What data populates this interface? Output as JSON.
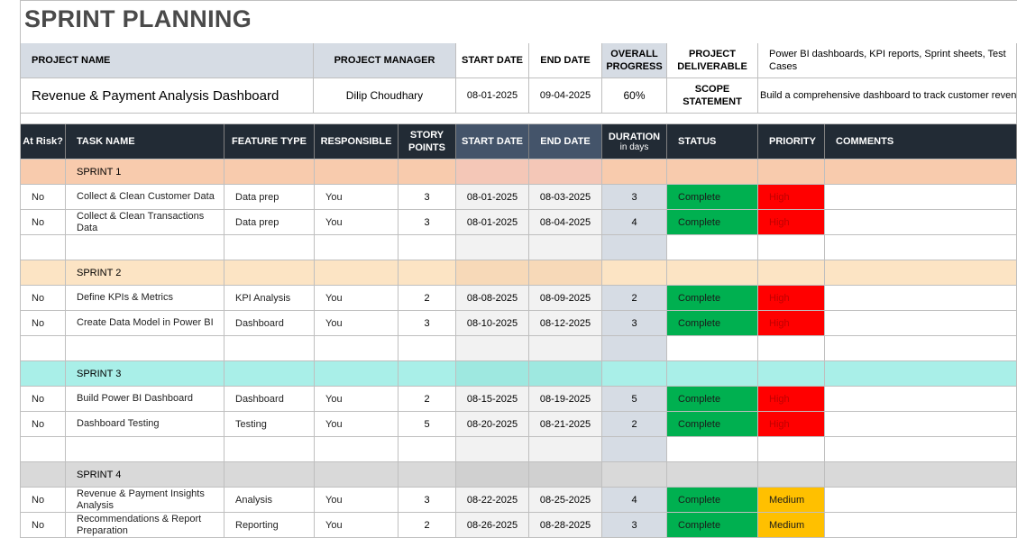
{
  "title": "SPRINT PLANNING",
  "project_header": {
    "project_name_label": "PROJECT NAME",
    "project_manager_label": "PROJECT MANAGER",
    "start_date_label": "START DATE",
    "end_date_label": "END DATE",
    "overall_progress_label": "OVERALL PROGRESS",
    "project_deliverable_label": "PROJECT DELIVERABLE",
    "project_deliverable_value": "Power BI dashboards, KPI reports, Sprint sheets, Test Cases",
    "project_name_value": "Revenue & Payment Analysis Dashboard",
    "project_manager_value": "Dilip Choudhary",
    "start_date_value": "08-01-2025",
    "end_date_value": "09-04-2025",
    "overall_progress_value": "60%",
    "scope_statement_label": "SCOPE STATEMENT",
    "scope_statement_value": "Build a comprehensive dashboard to track customer revenue"
  },
  "columns": {
    "at_risk": "At Risk?",
    "task_name": "TASK NAME",
    "feature_type": "FEATURE TYPE",
    "responsible": "RESPONSIBLE",
    "story_points": "STORY POINTS",
    "start_date": "START DATE",
    "end_date": "END DATE",
    "duration": "DURATION",
    "duration_sub": "in days",
    "status": "STATUS",
    "priority": "PRIORITY",
    "comments": "COMMENTS"
  },
  "sprints": [
    {
      "label": "SPRINT 1",
      "tasks": [
        {
          "at_risk": "No",
          "task": "Collect & Clean Customer Data",
          "feature": "Data prep",
          "responsible": "You",
          "points": "3",
          "start": "08-01-2025",
          "end": "08-03-2025",
          "duration": "3",
          "status": "Complete",
          "priority": "High"
        },
        {
          "at_risk": "No",
          "task": "Collect & Clean Transactions Data",
          "feature": "Data prep",
          "responsible": "You",
          "points": "3",
          "start": "08-01-2025",
          "end": "08-04-2025",
          "duration": "4",
          "status": "Complete",
          "priority": "High"
        }
      ]
    },
    {
      "label": "SPRINT 2",
      "tasks": [
        {
          "at_risk": "No",
          "task": "Define KPIs & Metrics",
          "feature": "KPI Analysis",
          "responsible": "You",
          "points": "2",
          "start": "08-08-2025",
          "end": "08-09-2025",
          "duration": "2",
          "status": "Complete",
          "priority": "High"
        },
        {
          "at_risk": "No",
          "task": "Create Data Model in Power BI",
          "feature": "Dashboard",
          "responsible": "You",
          "points": "3",
          "start": "08-10-2025",
          "end": "08-12-2025",
          "duration": "3",
          "status": "Complete",
          "priority": "High"
        }
      ]
    },
    {
      "label": "SPRINT 3",
      "tasks": [
        {
          "at_risk": "No",
          "task": "Build Power BI Dashboard",
          "feature": "Dashboard",
          "responsible": "You",
          "points": "2",
          "start": "08-15-2025",
          "end": "08-19-2025",
          "duration": "5",
          "status": "Complete",
          "priority": "High"
        },
        {
          "at_risk": "No",
          "task": "Dashboard Testing",
          "feature": "Testing",
          "responsible": "You",
          "points": "5",
          "start": "08-20-2025",
          "end": "08-21-2025",
          "duration": "2",
          "status": "Complete",
          "priority": "High"
        }
      ]
    },
    {
      "label": "SPRINT 4",
      "tasks": [
        {
          "at_risk": "No",
          "task": "Revenue & Payment Insights Analysis",
          "feature": "Analysis",
          "responsible": "You",
          "points": "3",
          "start": "08-22-2025",
          "end": "08-25-2025",
          "duration": "4",
          "status": "Complete",
          "priority": "Medium"
        },
        {
          "at_risk": "No",
          "task": "Recommendations & Report Preparation",
          "feature": "Reporting",
          "responsible": "You",
          "points": "2",
          "start": "08-26-2025",
          "end": "08-28-2025",
          "duration": "3",
          "status": "Complete",
          "priority": "Medium"
        }
      ]
    }
  ],
  "colors": {
    "status_complete": "#00b050",
    "priority_high": "#ff0000",
    "priority_medium": "#ffc000",
    "header_dark": "#222b35",
    "header_date": "#44546a",
    "sprint1": "#f8cbad",
    "sprint2": "#fce4c4",
    "sprint3": "#a9efe8",
    "sprint4": "#d9d9d9"
  }
}
